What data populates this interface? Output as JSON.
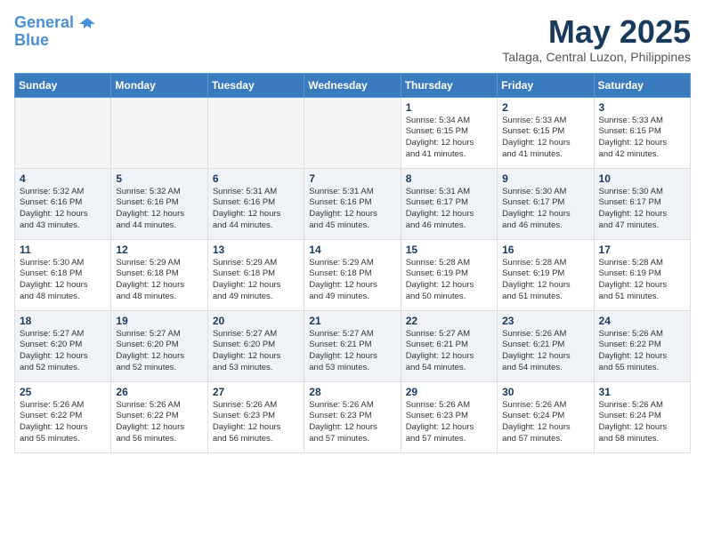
{
  "header": {
    "logo_line1": "General",
    "logo_line2": "Blue",
    "month_year": "May 2025",
    "location": "Talaga, Central Luzon, Philippines"
  },
  "days_of_week": [
    "Sunday",
    "Monday",
    "Tuesday",
    "Wednesday",
    "Thursday",
    "Friday",
    "Saturday"
  ],
  "weeks": [
    [
      {
        "day": "",
        "text": ""
      },
      {
        "day": "",
        "text": ""
      },
      {
        "day": "",
        "text": ""
      },
      {
        "day": "",
        "text": ""
      },
      {
        "day": "1",
        "text": "Sunrise: 5:34 AM\nSunset: 6:15 PM\nDaylight: 12 hours\nand 41 minutes."
      },
      {
        "day": "2",
        "text": "Sunrise: 5:33 AM\nSunset: 6:15 PM\nDaylight: 12 hours\nand 41 minutes."
      },
      {
        "day": "3",
        "text": "Sunrise: 5:33 AM\nSunset: 6:15 PM\nDaylight: 12 hours\nand 42 minutes."
      }
    ],
    [
      {
        "day": "4",
        "text": "Sunrise: 5:32 AM\nSunset: 6:16 PM\nDaylight: 12 hours\nand 43 minutes."
      },
      {
        "day": "5",
        "text": "Sunrise: 5:32 AM\nSunset: 6:16 PM\nDaylight: 12 hours\nand 44 minutes."
      },
      {
        "day": "6",
        "text": "Sunrise: 5:31 AM\nSunset: 6:16 PM\nDaylight: 12 hours\nand 44 minutes."
      },
      {
        "day": "7",
        "text": "Sunrise: 5:31 AM\nSunset: 6:16 PM\nDaylight: 12 hours\nand 45 minutes."
      },
      {
        "day": "8",
        "text": "Sunrise: 5:31 AM\nSunset: 6:17 PM\nDaylight: 12 hours\nand 46 minutes."
      },
      {
        "day": "9",
        "text": "Sunrise: 5:30 AM\nSunset: 6:17 PM\nDaylight: 12 hours\nand 46 minutes."
      },
      {
        "day": "10",
        "text": "Sunrise: 5:30 AM\nSunset: 6:17 PM\nDaylight: 12 hours\nand 47 minutes."
      }
    ],
    [
      {
        "day": "11",
        "text": "Sunrise: 5:30 AM\nSunset: 6:18 PM\nDaylight: 12 hours\nand 48 minutes."
      },
      {
        "day": "12",
        "text": "Sunrise: 5:29 AM\nSunset: 6:18 PM\nDaylight: 12 hours\nand 48 minutes."
      },
      {
        "day": "13",
        "text": "Sunrise: 5:29 AM\nSunset: 6:18 PM\nDaylight: 12 hours\nand 49 minutes."
      },
      {
        "day": "14",
        "text": "Sunrise: 5:29 AM\nSunset: 6:18 PM\nDaylight: 12 hours\nand 49 minutes."
      },
      {
        "day": "15",
        "text": "Sunrise: 5:28 AM\nSunset: 6:19 PM\nDaylight: 12 hours\nand 50 minutes."
      },
      {
        "day": "16",
        "text": "Sunrise: 5:28 AM\nSunset: 6:19 PM\nDaylight: 12 hours\nand 51 minutes."
      },
      {
        "day": "17",
        "text": "Sunrise: 5:28 AM\nSunset: 6:19 PM\nDaylight: 12 hours\nand 51 minutes."
      }
    ],
    [
      {
        "day": "18",
        "text": "Sunrise: 5:27 AM\nSunset: 6:20 PM\nDaylight: 12 hours\nand 52 minutes."
      },
      {
        "day": "19",
        "text": "Sunrise: 5:27 AM\nSunset: 6:20 PM\nDaylight: 12 hours\nand 52 minutes."
      },
      {
        "day": "20",
        "text": "Sunrise: 5:27 AM\nSunset: 6:20 PM\nDaylight: 12 hours\nand 53 minutes."
      },
      {
        "day": "21",
        "text": "Sunrise: 5:27 AM\nSunset: 6:21 PM\nDaylight: 12 hours\nand 53 minutes."
      },
      {
        "day": "22",
        "text": "Sunrise: 5:27 AM\nSunset: 6:21 PM\nDaylight: 12 hours\nand 54 minutes."
      },
      {
        "day": "23",
        "text": "Sunrise: 5:26 AM\nSunset: 6:21 PM\nDaylight: 12 hours\nand 54 minutes."
      },
      {
        "day": "24",
        "text": "Sunrise: 5:26 AM\nSunset: 6:22 PM\nDaylight: 12 hours\nand 55 minutes."
      }
    ],
    [
      {
        "day": "25",
        "text": "Sunrise: 5:26 AM\nSunset: 6:22 PM\nDaylight: 12 hours\nand 55 minutes."
      },
      {
        "day": "26",
        "text": "Sunrise: 5:26 AM\nSunset: 6:22 PM\nDaylight: 12 hours\nand 56 minutes."
      },
      {
        "day": "27",
        "text": "Sunrise: 5:26 AM\nSunset: 6:23 PM\nDaylight: 12 hours\nand 56 minutes."
      },
      {
        "day": "28",
        "text": "Sunrise: 5:26 AM\nSunset: 6:23 PM\nDaylight: 12 hours\nand 57 minutes."
      },
      {
        "day": "29",
        "text": "Sunrise: 5:26 AM\nSunset: 6:23 PM\nDaylight: 12 hours\nand 57 minutes."
      },
      {
        "day": "30",
        "text": "Sunrise: 5:26 AM\nSunset: 6:24 PM\nDaylight: 12 hours\nand 57 minutes."
      },
      {
        "day": "31",
        "text": "Sunrise: 5:26 AM\nSunset: 6:24 PM\nDaylight: 12 hours\nand 58 minutes."
      }
    ]
  ]
}
